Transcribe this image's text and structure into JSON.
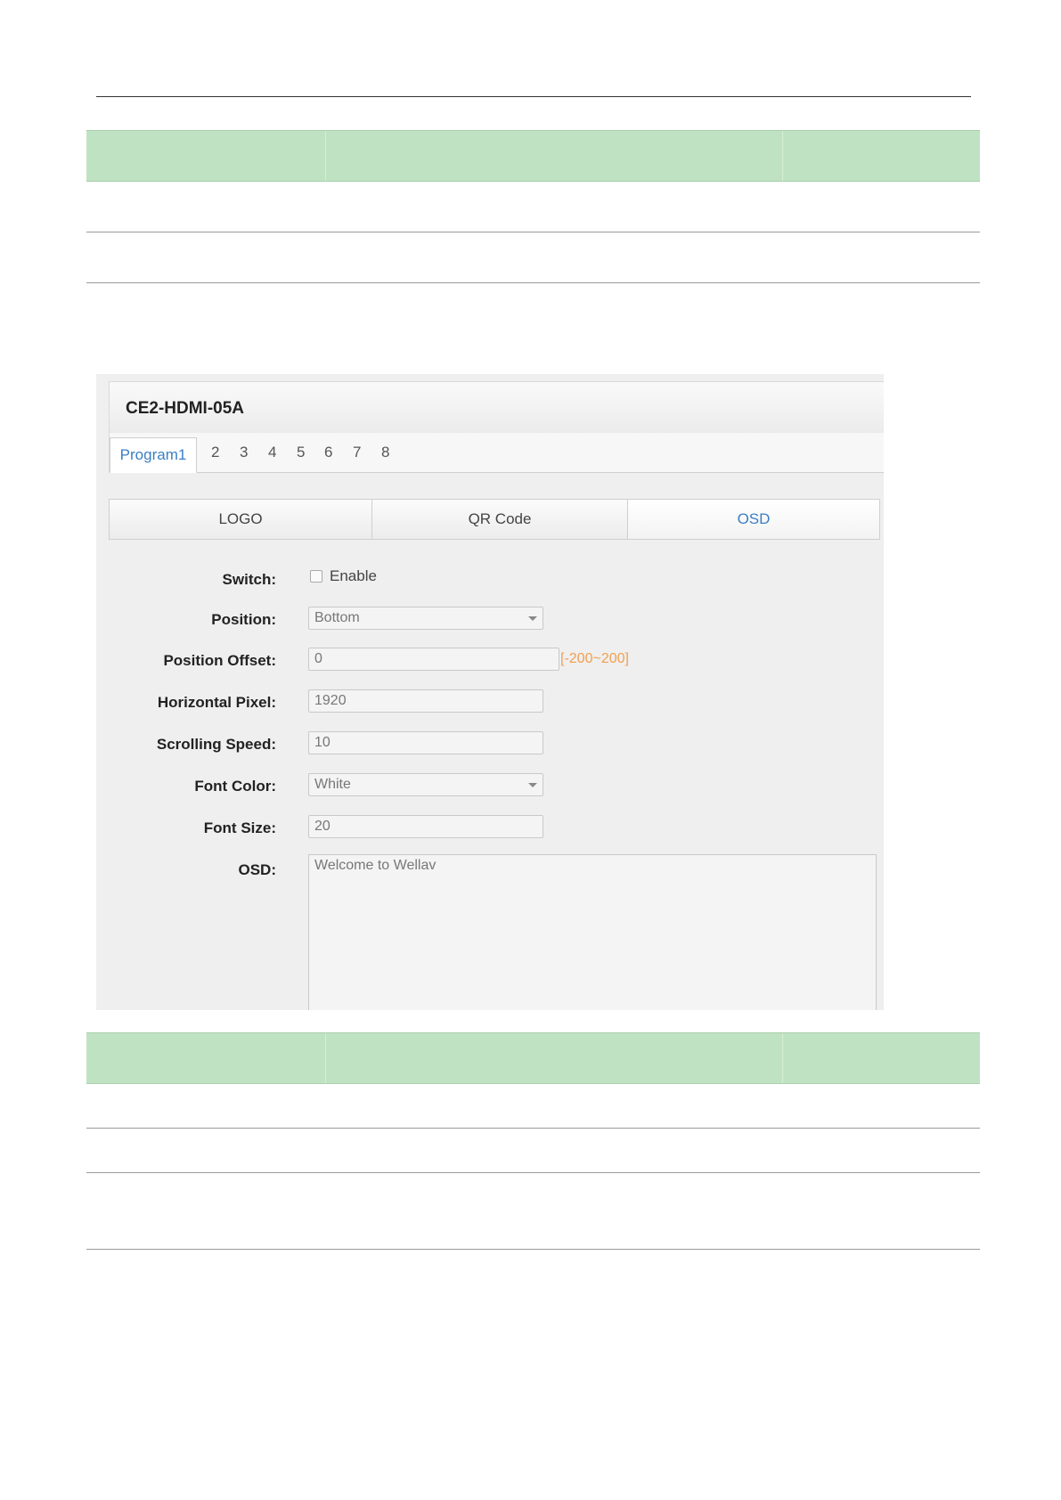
{
  "device": {
    "title": "CE2-HDMI-05A"
  },
  "program_tabs": {
    "active": "Program1",
    "others": [
      "2",
      "3",
      "4",
      "5",
      "6",
      "7",
      "8"
    ]
  },
  "sub_tabs": [
    "LOGO",
    "QR Code",
    "OSD"
  ],
  "sub_tab_active": "OSD",
  "form": {
    "switch_label": "Switch:",
    "switch_option": "Enable",
    "switch_checked": false,
    "position_label": "Position:",
    "position_value": "Bottom",
    "position_offset_label": "Position Offset:",
    "position_offset_value": "0",
    "position_offset_hint": "[-200~200]",
    "horizontal_pixel_label": "Horizontal Pixel:",
    "horizontal_pixel_value": "1920",
    "scrolling_speed_label": "Scrolling Speed:",
    "scrolling_speed_value": "10",
    "font_color_label": "Font Color:",
    "font_color_value": "White",
    "font_size_label": "Font Size:",
    "font_size_value": "20",
    "osd_label": "OSD:",
    "osd_value": "Welcome to Wellav"
  },
  "colors": {
    "table_header": "#bfe3c2",
    "accent_link": "#3a7fc4",
    "hint": "#f0a050"
  }
}
